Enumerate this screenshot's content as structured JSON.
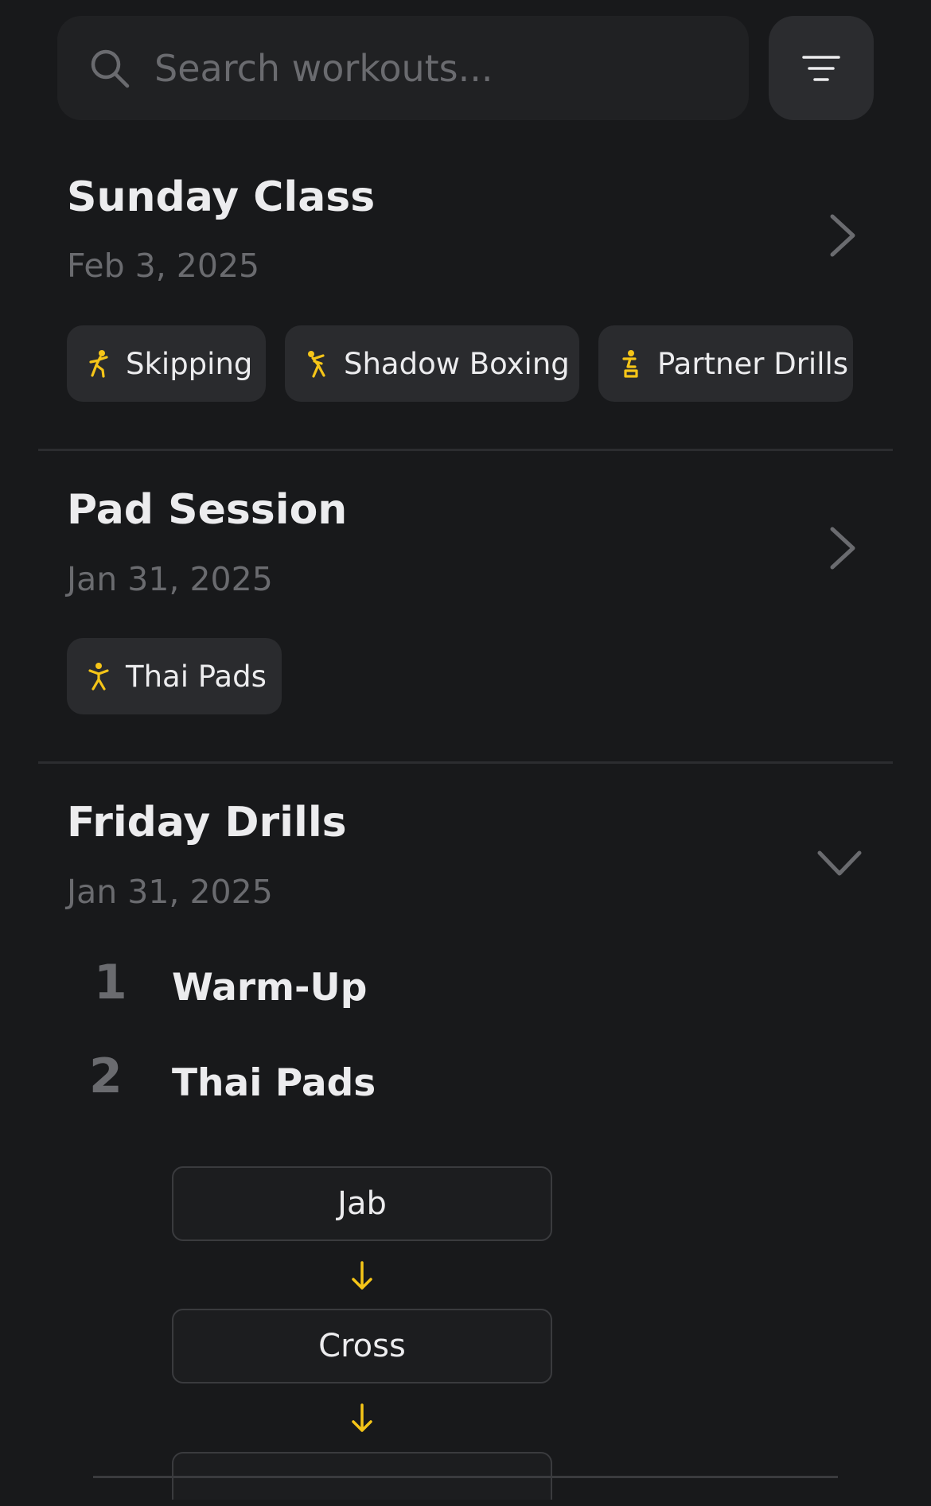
{
  "search": {
    "placeholder": "Search workouts..."
  },
  "colors": {
    "accent": "#f5c518",
    "background": "#18191b",
    "muted": "#6a6b6f",
    "tag_bg": "#2a2b2e"
  },
  "workouts": [
    {
      "title": "Sunday Class",
      "date": "Feb 3, 2025",
      "expanded": false,
      "tags": [
        {
          "label": "Skipping",
          "icon": "skipping-figure-icon"
        },
        {
          "label": "Shadow Boxing",
          "icon": "boxing-figure-icon"
        },
        {
          "label": "Partner Drills",
          "icon": "partner-figure-icon"
        }
      ]
    },
    {
      "title": "Pad Session",
      "date": "Jan 31, 2025",
      "expanded": false,
      "tags": [
        {
          "label": "Thai Pads",
          "icon": "star-figure-icon"
        }
      ]
    },
    {
      "title": "Friday Drills",
      "date": "Jan 31, 2025",
      "expanded": true,
      "steps": [
        {
          "number": "1",
          "name": "Warm-Up"
        },
        {
          "number": "2",
          "name": "Thai Pads"
        }
      ],
      "combo": [
        "Jab",
        "Cross"
      ]
    }
  ]
}
